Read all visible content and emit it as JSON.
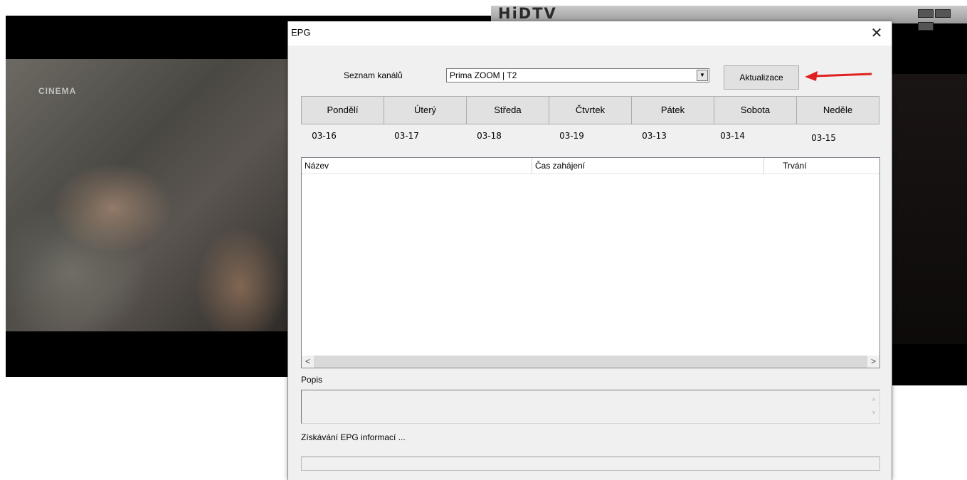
{
  "background": {
    "app_logo": "HiDTV",
    "channel_logo": "CINEMA"
  },
  "dialog": {
    "title": "EPG",
    "close_glyph": "✕",
    "channel_list_label": "Seznam kanálů",
    "channel_select_value": "Prima ZOOM | T2",
    "refresh_button": "Aktualizace",
    "annotation_color": "#e02020",
    "days": [
      {
        "label": "Pondělí",
        "date": "03-16"
      },
      {
        "label": "Úterý",
        "date": "03-17"
      },
      {
        "label": "Středa",
        "date": "03-18"
      },
      {
        "label": "Čtvrtek",
        "date": "03-19"
      },
      {
        "label": "Pátek",
        "date": "03-13"
      },
      {
        "label": "Sobota",
        "date": "03-14"
      },
      {
        "label": "Neděle",
        "date": "03-15"
      }
    ],
    "table": {
      "columns": [
        "Název",
        "Čas zahájení",
        "Trvání"
      ],
      "rows": []
    },
    "description_label": "Popis",
    "status_text": "Získávání EPG informací ..."
  }
}
